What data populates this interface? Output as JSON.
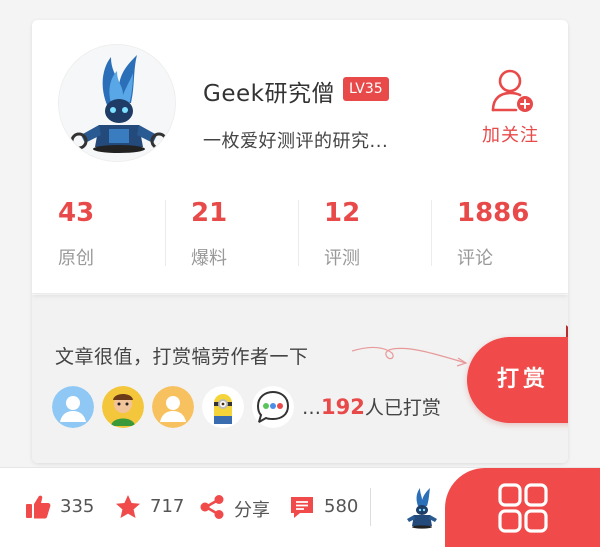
{
  "profile": {
    "username": "Geek研究僧",
    "level": "LV35",
    "bio": "一枚爱好测评的研究...",
    "follow_label": "加关注"
  },
  "stats": [
    {
      "value": "43",
      "label": "原创"
    },
    {
      "value": "21",
      "label": "爆料"
    },
    {
      "value": "12",
      "label": "评测"
    },
    {
      "value": "1886",
      "label": "评论"
    }
  ],
  "reward": {
    "prompt": "文章很值，打赏犒劳作者一下",
    "prefix": "…",
    "count": "192",
    "suffix": "人已打赏",
    "button_label": "打赏"
  },
  "actions": {
    "likes": "335",
    "favorites": "717",
    "share_label": "分享",
    "comments": "580"
  },
  "colors": {
    "accent": "#f04a4a",
    "stat_number": "#e84a4a",
    "muted_text": "#999999"
  },
  "icons": [
    "thumbs-up-icon",
    "star-icon",
    "share-icon",
    "comment-icon",
    "grid-menu-icon",
    "add-user-icon"
  ]
}
